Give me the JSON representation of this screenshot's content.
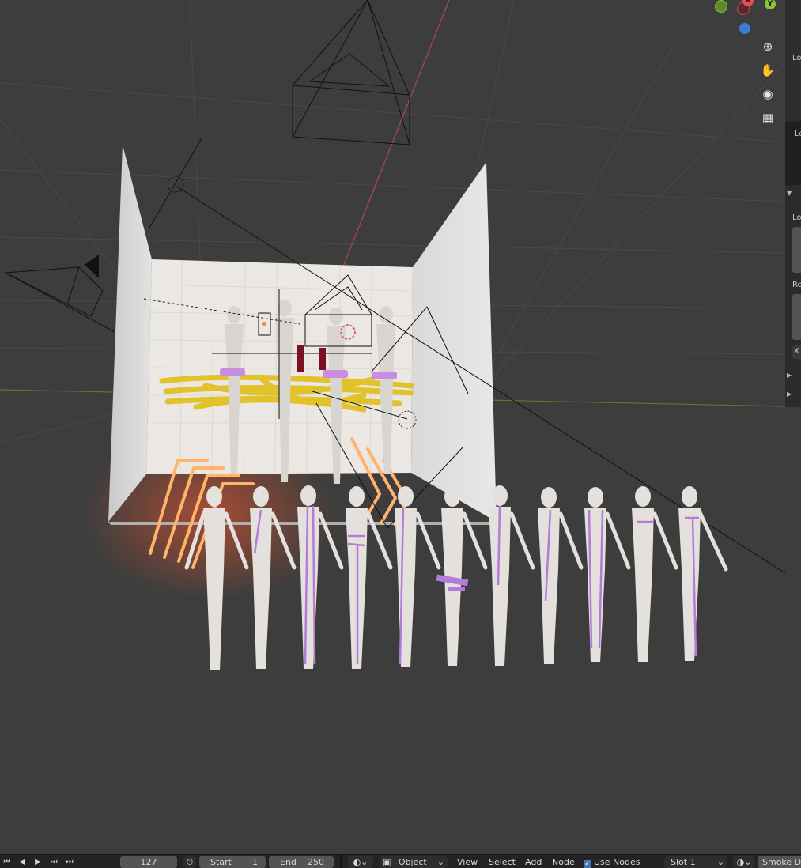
{
  "gizmo": {
    "x_label": "X",
    "y_label": "Y"
  },
  "nav_tools": [
    {
      "name": "zoom-icon",
      "glyph": "⊕"
    },
    {
      "name": "pan-hand-icon",
      "glyph": "✋"
    },
    {
      "name": "camera-view-icon",
      "glyph": "◉"
    },
    {
      "name": "grid-perspective-icon",
      "glyph": "▦"
    }
  ],
  "npanel": {
    "label_lo1": "Lo",
    "label_lo2": "Lo",
    "label_lo3": "Lo",
    "label_ro": "Ro",
    "label_x": "X"
  },
  "timeline": {
    "current_frame": "127",
    "start_label": "Start",
    "start_value": "1",
    "end_label": "End",
    "end_value": "250"
  },
  "node_header": {
    "mode": "Object",
    "menus": [
      "View",
      "Select",
      "Add",
      "Node"
    ],
    "use_nodes_label": "Use Nodes",
    "slot": "Slot 1",
    "material": "Smoke Do"
  },
  "colors": {
    "viewport_bg": "#3d3d3d",
    "x_axis": "#c8474f",
    "y_axis": "#79b82a",
    "z_axis": "#3c7cd6",
    "accent": "#4772b3"
  }
}
